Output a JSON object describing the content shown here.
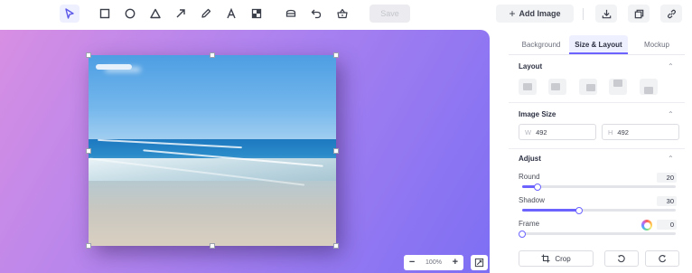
{
  "toolbar": {
    "tools": [
      {
        "name": "select-tool",
        "icon": "cursor-icon",
        "active": true
      },
      {
        "name": "rectangle-tool",
        "icon": "square-icon"
      },
      {
        "name": "circle-tool",
        "icon": "circle-icon"
      },
      {
        "name": "triangle-tool",
        "icon": "triangle-icon"
      },
      {
        "name": "arrow-tool",
        "icon": "arrow-icon"
      },
      {
        "name": "pen-tool",
        "icon": "pen-icon"
      },
      {
        "name": "text-tool",
        "icon": "text-icon"
      },
      {
        "name": "mosaic-tool",
        "icon": "mosaic-icon"
      },
      {
        "name": "eraser-tool",
        "icon": "eraser-icon"
      },
      {
        "name": "undo-tool",
        "icon": "undo-icon"
      },
      {
        "name": "sticker-tool",
        "icon": "basket-icon"
      }
    ],
    "save_label": "Save",
    "add_image_label": "Add Image",
    "right_icons": [
      "download-icon",
      "copy-icon",
      "link-icon"
    ]
  },
  "canvas": {
    "zoom_minus": "−",
    "zoom_value": "100%",
    "zoom_plus": "+",
    "fit_icon": "fit-screen-icon",
    "background_colors": [
      "#d78fe3",
      "#7d6ff3"
    ]
  },
  "panel": {
    "tabs": [
      "Background",
      "Size & Layout",
      "Mockup"
    ],
    "active_tab": "Size & Layout",
    "layout": {
      "title": "Layout",
      "options": [
        "layout-left",
        "layout-center-left",
        "layout-center",
        "layout-top",
        "layout-bottom"
      ]
    },
    "image_size": {
      "title": "Image Size",
      "width_prefix": "W",
      "width_value": "492",
      "height_prefix": "H",
      "height_value": "492"
    },
    "adjust": {
      "title": "Adjust",
      "round_label": "Round",
      "round_value": "20",
      "shadow_label": "Shadow",
      "shadow_value": "30",
      "frame_label": "Frame",
      "frame_value": "0"
    },
    "buttons": {
      "crop_label": "Crop",
      "rotate_left_icon": "rotate-left-icon",
      "rotate_right_icon": "rotate-right-icon"
    }
  },
  "colors": {
    "accent": "#6c63ff",
    "canvas_start": "#d78fe3",
    "canvas_end": "#7d6ff3"
  }
}
